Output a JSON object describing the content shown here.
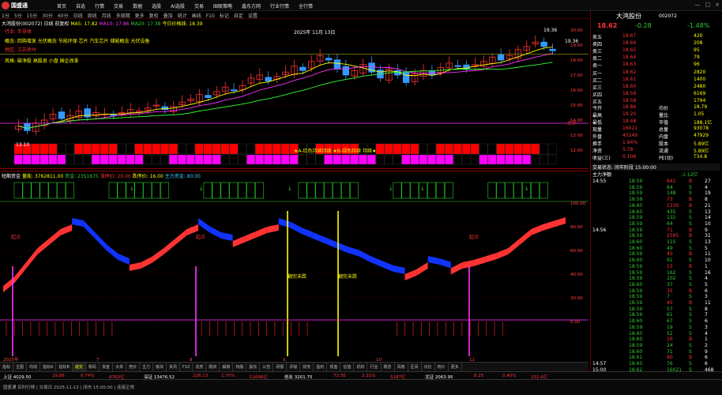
{
  "app": {
    "title": "国盛通"
  },
  "menu": {
    "items": [
      "首页",
      "自选",
      "行情",
      "交易",
      "数据",
      "选股",
      "AI选股",
      "交易",
      "国联策略",
      "鑫东方网",
      "行业行情",
      "全行情"
    ]
  },
  "window": {
    "controls": [
      "—",
      "□",
      "×"
    ]
  },
  "timeframes": [
    "1分",
    "5分",
    "15分",
    "30分",
    "60分",
    "日线",
    "周线",
    "月线",
    "多周期",
    "更多",
    "复权",
    "叠加",
    "统计",
    "画线",
    "F10",
    "标记",
    "自定",
    "设置"
  ],
  "main_chart": {
    "stock_line": "大鸿股份(002072)  日线 前复权",
    "ma_label": "MA5: 17.82",
    "ma10": "MA10: 17.86",
    "ma20": "MA20: 17.38",
    "today_label": "今日价格线: 18.39",
    "date_label": "2025年 11月 13日",
    "high_label": "19.36",
    "low_label": "13.10",
    "right_low": "19.36",
    "industry": "行业: 半导体",
    "region": "地区: 江苏徐州",
    "concept_label": "概念: 回购增发 光伏概念 节能环保 芯片 汽车芯片 储能概念 光伏设备",
    "news_label": "风格: 破净股 高股息 小盘 国企改革",
    "band_text": "★A-红色持续持续 ★B-绿色持续 持续★",
    "ann": "点评"
  },
  "yaxis_main": [
    "20.00",
    "19.00",
    "18.00",
    "17.00",
    "16.00",
    "15.00",
    "14.00",
    "13.00",
    "12.00"
  ],
  "sub_chart": {
    "title": "短期资金",
    "vol_label": "量能: 3762811.00",
    "v2": "资金: 2351675",
    "v3": "涨停价: 20.00",
    "v4": "跌停价: 16.00",
    "v5": "主力资金: 80.00",
    "labels": [
      "起点",
      "起点",
      "起点",
      "翻完未跌",
      "翻完未跌"
    ]
  },
  "yaxis_sub": [
    "100.00",
    "80.00",
    "60.00",
    "40.00",
    "20.00",
    "0.00"
  ],
  "dates": [
    "2025年",
    "7",
    "8",
    "9",
    "10",
    "11"
  ],
  "quote": {
    "name": "大鸿股份",
    "code": "002072",
    "price": "18.62",
    "change": "-0.28",
    "pct": "-1.48%",
    "asks": [
      {
        "l": "卖五",
        "p": "18.67",
        "v": "420"
      },
      {
        "l": "卖四",
        "p": "18.66",
        "v": "208"
      },
      {
        "l": "卖三",
        "p": "18.65",
        "v": "95"
      },
      {
        "l": "卖二",
        "p": "18.64",
        "v": "79"
      },
      {
        "l": "卖一",
        "p": "18.63",
        "v": "96"
      }
    ],
    "bids": [
      {
        "l": "买一",
        "p": "18.62",
        "v": "2820"
      },
      {
        "l": "买二",
        "p": "18.61",
        "v": "1400"
      },
      {
        "l": "买三",
        "p": "18.60",
        "v": "2480"
      },
      {
        "l": "买四",
        "p": "18.59",
        "v": "6169"
      },
      {
        "l": "买五",
        "p": "18.58",
        "v": "1794"
      }
    ],
    "stats": [
      {
        "a": "今开",
        "av": "18.86",
        "b": "均价",
        "bv": "18.79"
      },
      {
        "a": "最高",
        "av": "19.20",
        "b": "量比",
        "bv": "1.05"
      },
      {
        "a": "最低",
        "av": "18.48",
        "b": "市值",
        "bv": "188.1亿"
      },
      {
        "a": "现量",
        "av": "16021",
        "b": "总量",
        "bv": "93078"
      },
      {
        "a": "外盘",
        "av": "45149",
        "b": "内盘",
        "bv": "47929"
      },
      {
        "a": "换手",
        "av": "1.94%",
        "b": "股本",
        "bv": "5.89亿"
      },
      {
        "a": "净资",
        "av": "5.78",
        "b": "流通",
        "bv": "5.89亿"
      },
      {
        "a": "收益(三)",
        "av": "0.108",
        "b": "PE(动)",
        "bv": "T34.8"
      }
    ],
    "trade_status": "交易状态: 闭市阶段 15:00:00",
    "main_force": "主力净额",
    "mf_val": "-1.12亿"
  },
  "ticks": [
    {
      "t": "14:55",
      "p": "18.59",
      "v": "641",
      "d": "B",
      "n": "27"
    },
    {
      "t": "",
      "p": "18.59",
      "v": "64",
      "d": "S",
      "n": "4"
    },
    {
      "t": "",
      "p": "18.59",
      "v": "148",
      "d": "S",
      "n": "19"
    },
    {
      "t": "",
      "p": "18.59",
      "v": "73",
      "d": "B",
      "n": "8"
    },
    {
      "t": "",
      "p": "18.60",
      "v": "1330",
      "d": "B",
      "n": "21"
    },
    {
      "t": "",
      "p": "18.60",
      "v": "435",
      "d": "S",
      "n": "13"
    },
    {
      "t": "",
      "p": "18.59",
      "v": "132",
      "d": "S",
      "n": "14"
    },
    {
      "t": "",
      "p": "18.59",
      "v": "64",
      "d": "S",
      "n": "10"
    },
    {
      "t": "14:56",
      "p": "18.59",
      "v": "71",
      "d": "B",
      "n": "9"
    },
    {
      "t": "",
      "p": "18.59",
      "v": "2595",
      "d": "B",
      "n": "31"
    },
    {
      "t": "",
      "p": "18.60",
      "v": "115",
      "d": "S",
      "n": "13"
    },
    {
      "t": "",
      "p": "18.60",
      "v": "49",
      "d": "S",
      "n": "5"
    },
    {
      "t": "",
      "p": "18.59",
      "v": "45",
      "d": "B",
      "n": "11"
    },
    {
      "t": "",
      "p": "18.60",
      "v": "91",
      "d": "S",
      "n": "10"
    },
    {
      "t": "",
      "p": "18.59",
      "v": "13",
      "d": "B",
      "n": "1"
    },
    {
      "t": "",
      "p": "18.59",
      "v": "162",
      "d": "S",
      "n": "16"
    },
    {
      "t": "",
      "p": "18.59",
      "v": "102",
      "d": "S",
      "n": "4"
    },
    {
      "t": "",
      "p": "18.60",
      "v": "37",
      "d": "S",
      "n": "5"
    },
    {
      "t": "",
      "p": "18.59",
      "v": "35",
      "d": "B",
      "n": "6"
    },
    {
      "t": "",
      "p": "18.59",
      "v": "7",
      "d": "S",
      "n": "3"
    },
    {
      "t": "",
      "p": "18.59",
      "v": "45",
      "d": "B",
      "n": "11"
    },
    {
      "t": "",
      "p": "18.59",
      "v": "57",
      "d": "S",
      "n": "8"
    },
    {
      "t": "",
      "p": "18.59",
      "v": "61",
      "d": "S",
      "n": "7"
    },
    {
      "t": "",
      "p": "18.60",
      "v": "67",
      "d": "S",
      "n": "6"
    },
    {
      "t": "",
      "p": "18.59",
      "v": "19",
      "d": "S",
      "n": "3"
    },
    {
      "t": "",
      "p": "18.60",
      "v": "52",
      "d": "S",
      "n": "4"
    },
    {
      "t": "",
      "p": "18.60",
      "v": "16",
      "d": "B",
      "n": "1"
    },
    {
      "t": "",
      "p": "18.59",
      "v": "24",
      "d": "S",
      "n": "2"
    },
    {
      "t": "",
      "p": "18.60",
      "v": "71",
      "d": "S",
      "n": "9"
    },
    {
      "t": "",
      "p": "18.61",
      "v": "60",
      "d": "B",
      "n": "6"
    },
    {
      "t": "14:57",
      "p": "18.60",
      "v": "76",
      "d": "S",
      "n": "6"
    },
    {
      "t": "15:00",
      "p": "18.62",
      "v": "16021",
      "d": "S",
      "n": "468"
    }
  ],
  "bottom_tabs": [
    "指标",
    "主图",
    "均线",
    "指标A",
    "指标B",
    "成交",
    "筹码",
    "资金",
    "大单",
    "竞价",
    "主力",
    "板块",
    "资讯",
    "F10",
    "龙虎",
    "融资",
    "解禁",
    "持股",
    "股东",
    "公告",
    "研报",
    "评级",
    "财务",
    "盈利",
    "现金",
    "估值",
    "机构",
    "行业",
    "概念",
    "风格",
    "区间",
    "对比",
    "统计",
    "更多"
  ],
  "index_bar": [
    "上证 4029.50",
    "29.86",
    "0.74%",
    "8763亿",
    "深证 13476.52",
    "226.13",
    "1.70%",
    "11666亿",
    "创业 3201.75",
    "72.30",
    "2.31%",
    "5287亿",
    "北证 2063.95",
    "8.25",
    "0.40%",
    "151.6亿"
  ],
  "status_text": "国盛通 实时行情 | 交易日 2025-11-13 | 闭市 15:00:00 | 连接正常",
  "colors": {
    "up": "#ff3333",
    "down": "#00cc66",
    "accent": "#ffff00",
    "bg": "#000000"
  },
  "chart_data": {
    "type": "line",
    "candle_close": [
      13.6,
      13.3,
      13.8,
      14.0,
      14.4,
      14.1,
      14.3,
      14.6,
      14.2,
      14.5,
      14.4,
      14.3,
      14.5,
      14.7,
      14.6,
      14.8,
      15.0,
      14.7,
      14.9,
      15.2,
      15.4,
      15.7,
      15.5,
      15.9,
      16.2,
      16.0,
      16.3,
      16.8,
      17.0,
      16.6,
      16.9,
      17.2,
      17.6,
      17.3,
      17.9,
      18.3,
      18.0,
      17.4,
      17.0,
      17.3,
      17.7,
      17.2,
      16.8,
      17.4,
      17.0,
      16.5,
      17.1,
      17.3,
      17.0,
      17.5,
      17.8,
      17.6,
      17.4,
      17.7,
      17.9,
      18.2,
      18.0,
      18.3,
      18.7,
      18.9,
      19.2,
      18.9,
      18.62
    ],
    "osc": [
      30,
      38,
      50,
      62,
      70,
      78,
      82,
      80,
      70,
      60,
      52,
      48,
      50,
      55,
      62,
      70,
      78,
      82,
      75,
      70,
      68,
      72,
      76,
      80,
      82,
      79,
      74,
      70,
      66,
      62,
      58,
      55,
      50,
      46,
      42,
      40,
      44,
      50,
      48,
      45,
      50,
      52,
      55,
      58,
      62,
      70,
      78,
      82,
      85,
      88
    ]
  }
}
